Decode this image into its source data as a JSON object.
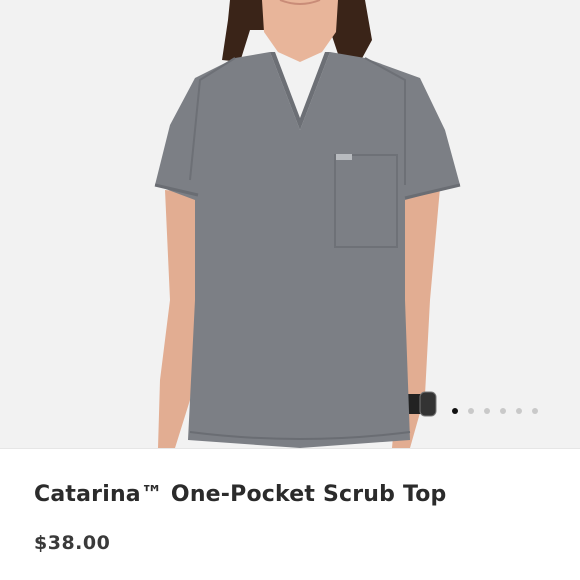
{
  "product": {
    "title": "Catarina™ One-Pocket Scrub Top",
    "price": "$38.00",
    "image": {
      "subject": "woman wearing gray scrub top",
      "colors": {
        "background": "#f2f2f2",
        "garment": "#7c7f85",
        "skin": "#e8b59a",
        "hair": "#3a2418"
      }
    },
    "carousel": {
      "total_images": 6,
      "active_index": 0
    }
  }
}
